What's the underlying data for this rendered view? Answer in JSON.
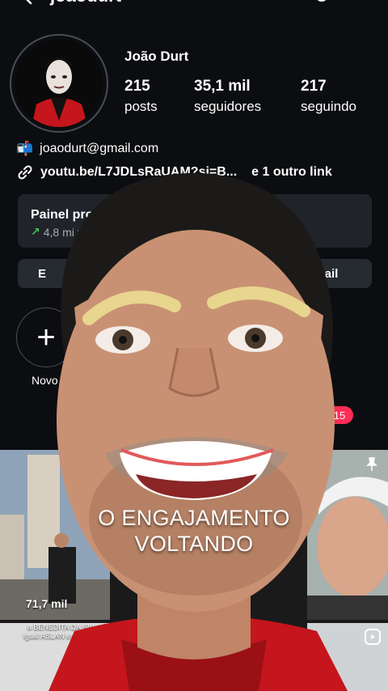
{
  "header": {
    "username_partial": "joaodurt"
  },
  "profile": {
    "display_name": "João Durt",
    "stats": [
      {
        "value": "215",
        "label": "posts"
      },
      {
        "value": "35,1 mil",
        "label": "seguidores"
      },
      {
        "value": "217",
        "label": "seguindo"
      }
    ],
    "email": "joaodurt@gmail.com",
    "link": "youtu.be/L7JDLsRaUAM?si=B...",
    "link_extra": "e 1 outro link"
  },
  "dashboard": {
    "title": "Painel profis",
    "sub": "4,8 mi vi"
  },
  "buttons": {
    "edit_partial": "E",
    "email_partial": "ail"
  },
  "highlights": {
    "new_label": "Novo"
  },
  "notifications": {
    "badge": "15"
  },
  "grid": {
    "views": "71,7 mil",
    "caption": "a BENEDITA DA SILVA igual ASLAN em NÁRNIA"
  },
  "overlay": {
    "line1": "O ENGAJAMENTO",
    "line2": "VOLTANDO"
  },
  "colors": {
    "accent_badge": "#ff2d55",
    "panel_bg": "#20232a",
    "shirt": "#c4161c",
    "trend_green": "#3fbf5a"
  }
}
